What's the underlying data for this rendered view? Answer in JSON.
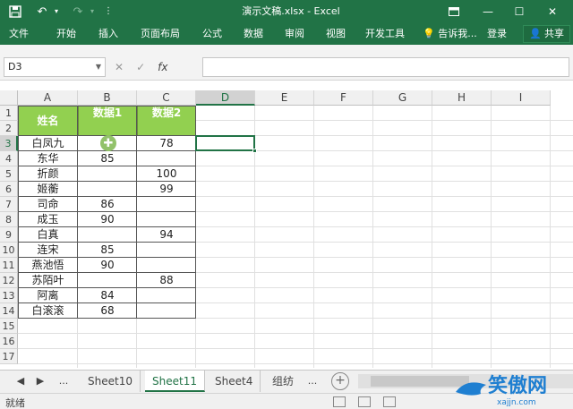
{
  "window": {
    "title": "演示文稿.xlsx - Excel"
  },
  "ribbon": {
    "tabs": [
      "文件",
      "开始",
      "插入",
      "页面布局",
      "公式",
      "数据",
      "审阅",
      "视图",
      "开发工具"
    ],
    "tell_me": "告诉我...",
    "login": "登录",
    "share": "共享"
  },
  "formula_bar": {
    "name_box": "D3",
    "cancel": "✕",
    "enter": "✓",
    "fx": "fx",
    "content": ""
  },
  "columns": [
    "A",
    "B",
    "C",
    "D",
    "E",
    "F",
    "G",
    "H",
    "I"
  ],
  "rows": [
    "1",
    "2",
    "3",
    "4",
    "5",
    "6",
    "7",
    "8",
    "9",
    "10",
    "11",
    "12",
    "13",
    "14",
    "15",
    "16",
    "17"
  ],
  "table": {
    "headers": [
      "姓名",
      "数据1",
      "数据2"
    ],
    "rows": [
      [
        "白凤九",
        "",
        "78"
      ],
      [
        "东华",
        "85",
        ""
      ],
      [
        "折颜",
        "",
        "100"
      ],
      [
        "姬蘅",
        "",
        "99"
      ],
      [
        "司命",
        "86",
        ""
      ],
      [
        "成玉",
        "90",
        ""
      ],
      [
        "白真",
        "",
        "94"
      ],
      [
        "连宋",
        "85",
        ""
      ],
      [
        "燕池悟",
        "90",
        ""
      ],
      [
        "苏陌叶",
        "",
        "88"
      ],
      [
        "阿离",
        "84",
        ""
      ],
      [
        "白滚滚",
        "68",
        ""
      ]
    ]
  },
  "selected_cell": "D3",
  "sheets": {
    "tabs": [
      "Sheet10",
      "Sheet11",
      "Sheet4",
      "组纺"
    ],
    "active": "Sheet11",
    "more": "..."
  },
  "status": {
    "text": "就绪"
  },
  "watermark": {
    "text": "笑傲网",
    "sub": "xajjn.com"
  },
  "colors": {
    "accent": "#217346",
    "header_fill": "#92d050"
  }
}
